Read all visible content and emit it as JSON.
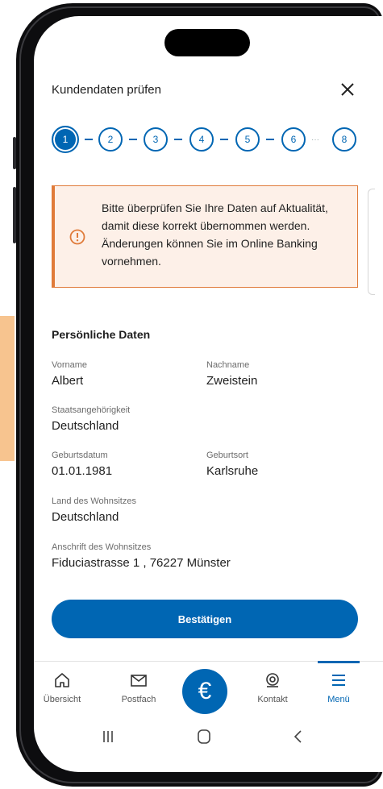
{
  "header": {
    "title": "Kundendaten prüfen",
    "close_icon": "close-icon"
  },
  "steps": {
    "items": [
      "1",
      "2",
      "3",
      "4",
      "5",
      "6",
      "8"
    ],
    "active": "1",
    "ellipsis": "···"
  },
  "alert": {
    "text": "Bitte überprüfen Sie Ihre Daten auf Aktualität, damit diese korrekt übernommen werden. Änderungen können Sie im Online Banking vornehmen.",
    "icon": "warning-icon",
    "accent_color": "#e07b3a"
  },
  "personal": {
    "title": "Persönliche Daten",
    "first_name": {
      "label": "Vorname",
      "value": "Albert"
    },
    "last_name": {
      "label": "Nachname",
      "value": "Zweistein"
    },
    "nationality": {
      "label": "Staatsangehörigkeit",
      "value": "Deutschland"
    },
    "birth_date": {
      "label": "Geburtsdatum",
      "value": "01.01.1981"
    },
    "birth_place": {
      "label": "Geburtsort",
      "value": "Karlsruhe"
    },
    "country": {
      "label": "Land des Wohnsitzes",
      "value": "Deutschland"
    },
    "address": {
      "label": "Anschrift des Wohnsitzes",
      "value": "Fiduciastrasse 1 , 76227 Münster"
    }
  },
  "confirm_label": "Bestätigen",
  "nav": {
    "overview": "Übersicht",
    "inbox": "Postfach",
    "euro_symbol": "€",
    "contact": "Kontakt",
    "menu": "Menü"
  },
  "colors": {
    "primary": "#0066b3",
    "alert_bg": "#fdf0e8"
  }
}
